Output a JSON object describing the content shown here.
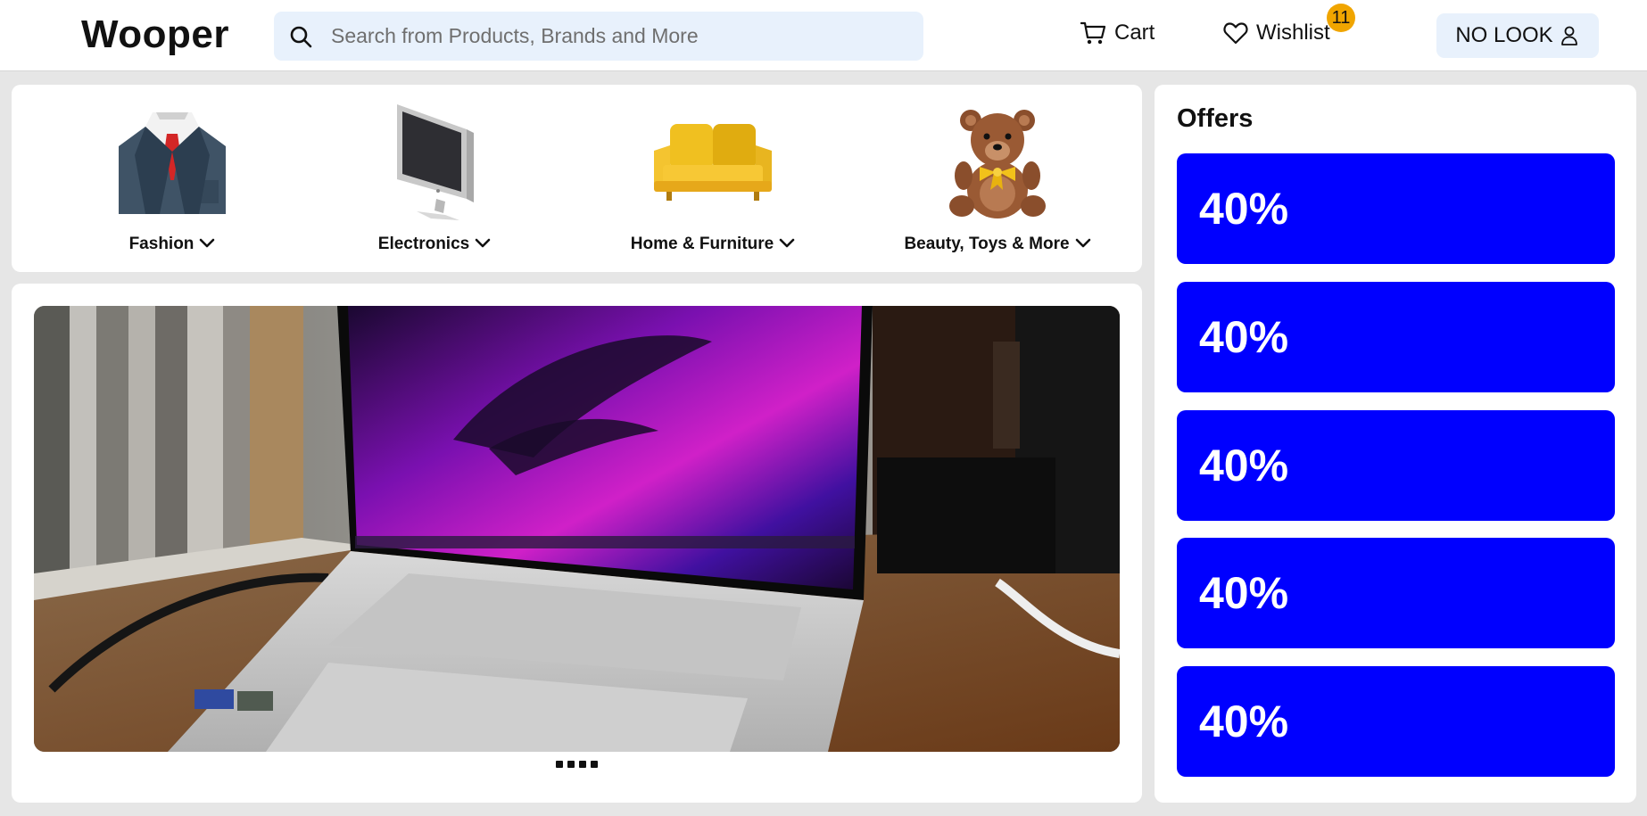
{
  "header": {
    "logo": "Wooper",
    "search_placeholder": "Search from Products, Brands and More",
    "cart_label": "Cart",
    "wishlist_label": "Wishlist",
    "wishlist_count": "11",
    "account_label": "NO LOOK"
  },
  "categories": [
    {
      "label": "Fashion",
      "icon": "suit-icon"
    },
    {
      "label": "Electronics",
      "icon": "monitor-icon"
    },
    {
      "label": "Home & Furniture",
      "icon": "sofa-icon"
    },
    {
      "label": "Beauty, Toys & More",
      "icon": "teddy-bear-icon"
    }
  ],
  "banner": {
    "image": "laptop-photo",
    "slide_count": 4
  },
  "offers": {
    "title": "Offers",
    "items": [
      "40%",
      "40%",
      "40%",
      "40%",
      "40%"
    ]
  },
  "colors": {
    "offer_bg": "#0000ff",
    "search_bg": "#e8f1fc",
    "badge": "#f0a500",
    "page_bg": "#e6e6e6"
  }
}
